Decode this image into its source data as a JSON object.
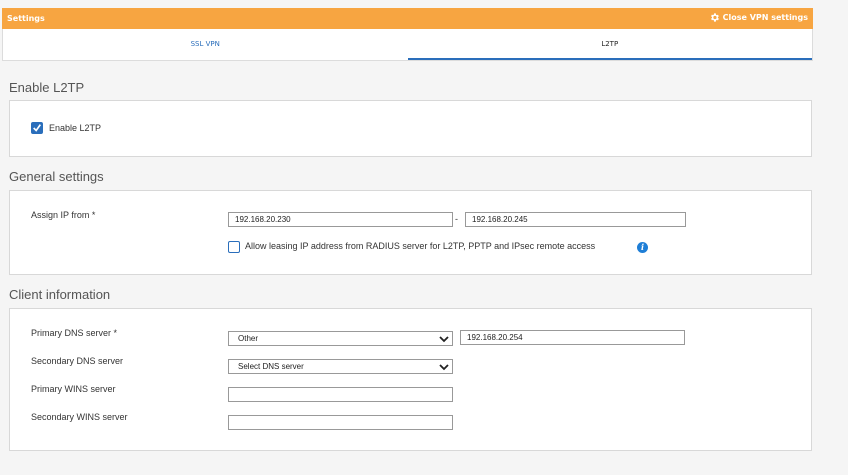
{
  "topbar": {
    "title": "Settings",
    "close_label": "Close VPN settings",
    "close_icon": "gear-icon"
  },
  "tabs": [
    {
      "label": "SSL VPN",
      "active": false
    },
    {
      "label": "L2TP",
      "active": true
    }
  ],
  "enable_section": {
    "title": "Enable L2TP",
    "checkbox_label": "Enable L2TP",
    "checked": true
  },
  "general": {
    "title": "General settings",
    "assign_ip_label": "Assign IP from *",
    "ip_from": "192.168.20.230",
    "ip_sep": "-",
    "ip_to": "192.168.20.245",
    "radius_label": "Allow leasing IP address from RADIUS server for L2TP, PPTP and IPsec remote access",
    "radius_checked": false,
    "info_glyph": "i"
  },
  "client": {
    "title": "Client information",
    "primary_dns_label": "Primary DNS server *",
    "primary_dns_select": "Other",
    "primary_dns_value": "192.168.20.254",
    "secondary_dns_label": "Secondary DNS server",
    "secondary_dns_select": "Select DNS server",
    "primary_wins_label": "Primary WINS server",
    "primary_wins_value": "",
    "secondary_wins_label": "Secondary WINS server",
    "secondary_wins_value": ""
  },
  "colors": {
    "accent_orange": "#f7a541",
    "link_blue": "#2a6ebb"
  }
}
